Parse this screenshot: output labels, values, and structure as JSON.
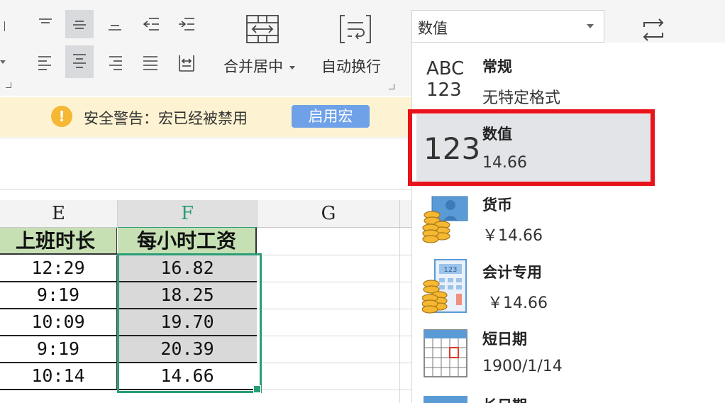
{
  "ribbon": {
    "merge_center_label": "合并居中",
    "wrap_text_label": "自动换行",
    "number_format_value": "数值"
  },
  "warning": {
    "text": "安全警告：宏已经被禁用",
    "enable_button": "启用宏",
    "icon": "!"
  },
  "sheet": {
    "columns": [
      "E",
      "F",
      "G"
    ],
    "selected_column": "F",
    "headers": {
      "E": "上班时长",
      "F": "每小时工资"
    },
    "rows": [
      {
        "e": "12:29",
        "f": "16.82"
      },
      {
        "e": "9:19",
        "f": "18.25"
      },
      {
        "e": "10:09",
        "f": "19.70"
      },
      {
        "e": "9:19",
        "f": "20.39"
      },
      {
        "e": "10:14",
        "f": "14.66"
      }
    ]
  },
  "format_menu": {
    "items": [
      {
        "icon": "abc-123-icon",
        "icon_text_top": "ABC",
        "icon_text_bottom": "123",
        "title": "常规",
        "subtitle": "无特定格式"
      },
      {
        "icon": "number-123-icon",
        "icon_text": "123",
        "title": "数值",
        "subtitle": "14.66",
        "selected": true
      },
      {
        "icon": "currency-coins-icon",
        "title": "货币",
        "subtitle": "￥14.66"
      },
      {
        "icon": "accounting-calculator-icon",
        "icon_text": "123",
        "title": "会计专用",
        "subtitle": "￥14.66"
      },
      {
        "icon": "calendar-icon",
        "title": "短日期",
        "subtitle": "1900/1/14"
      },
      {
        "icon": "calendar-long-icon",
        "title": "长日期"
      }
    ]
  },
  "colors": {
    "selection_green": "#2a9d77",
    "highlight_red": "#e8131b",
    "header_green": "#c6e0b4",
    "enable_blue": "#6fa1e8",
    "warning_yellow": "#fdf3d2"
  }
}
